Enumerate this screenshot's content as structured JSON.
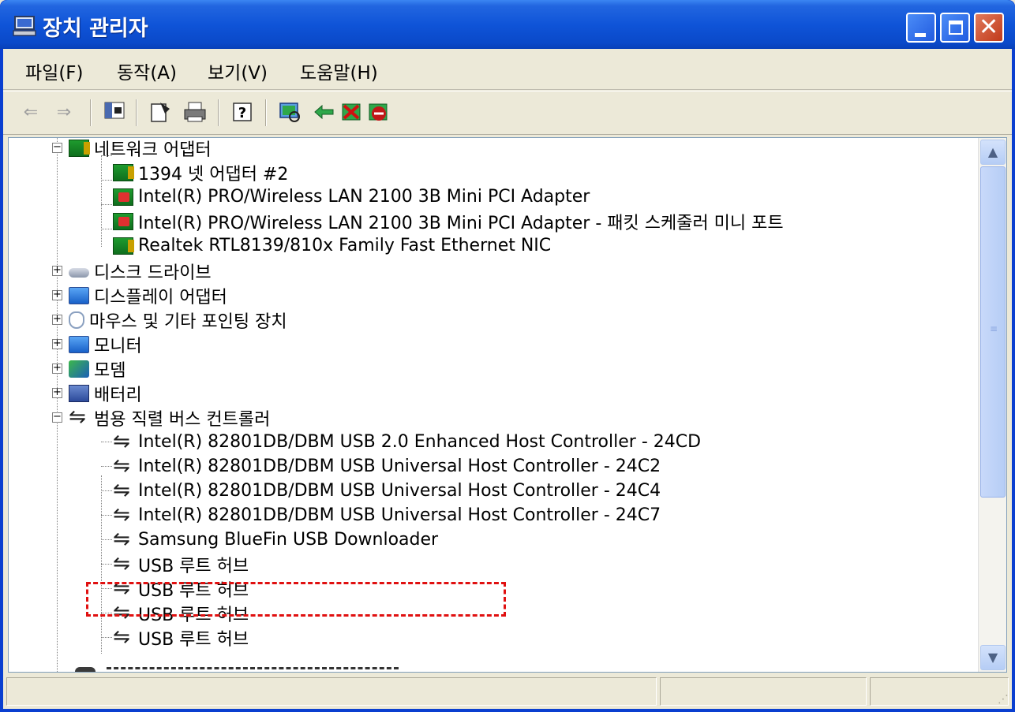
{
  "window": {
    "title": "장치 관리자",
    "controls": [
      "minimize",
      "maximize",
      "close"
    ]
  },
  "menu": [
    {
      "label": "파일(F)"
    },
    {
      "label": "동작(A)"
    },
    {
      "label": "보기(V)"
    },
    {
      "label": "도움말(H)"
    }
  ],
  "toolbar": {
    "icons": [
      "back-arrow-icon",
      "forward-arrow-icon",
      "show-hide-console-tree-icon",
      "properties-icon",
      "print-icon",
      "help-icon",
      "scan-hardware-icon",
      "update-driver-icon",
      "uninstall-icon",
      "disable-icon"
    ]
  },
  "tree": {
    "items": [
      {
        "label": "네트워크 어댑터",
        "level": 0,
        "expanded": true,
        "icon": "network-adapter-icon"
      },
      {
        "label": "1394 넷 어댑터 #2",
        "level": 1,
        "icon": "network-adapter-icon"
      },
      {
        "label": "Intel(R) PRO/Wireless LAN 2100 3B Mini PCI Adapter",
        "level": 1,
        "icon": "wireless-adapter-icon"
      },
      {
        "label": "Intel(R) PRO/Wireless LAN 2100 3B Mini PCI Adapter - 패킷 스케줄러 미니 포트",
        "level": 1,
        "icon": "wireless-adapter-icon"
      },
      {
        "label": "Realtek RTL8139/810x Family Fast Ethernet NIC",
        "level": 1,
        "icon": "network-adapter-icon"
      },
      {
        "label": "디스크 드라이브",
        "level": 0,
        "expanded": false,
        "icon": "disk-drive-icon"
      },
      {
        "label": "디스플레이 어댑터",
        "level": 0,
        "expanded": false,
        "icon": "display-adapter-icon"
      },
      {
        "label": "마우스 및 기타 포인팅 장치",
        "level": 0,
        "expanded": false,
        "icon": "mouse-icon"
      },
      {
        "label": "모니터",
        "level": 0,
        "expanded": false,
        "icon": "monitor-icon"
      },
      {
        "label": "모뎀",
        "level": 0,
        "expanded": false,
        "icon": "modem-icon"
      },
      {
        "label": "배터리",
        "level": 0,
        "expanded": false,
        "icon": "battery-icon"
      },
      {
        "label": "범용 직렬 버스 컨트롤러",
        "level": 0,
        "expanded": true,
        "icon": "usb-icon"
      },
      {
        "label": "Intel(R) 82801DB/DBM USB 2.0 Enhanced Host Controller - 24CD",
        "level": 1,
        "icon": "usb-icon"
      },
      {
        "label": "Intel(R) 82801DB/DBM USB Universal Host Controller - 24C2",
        "level": 1,
        "icon": "usb-icon"
      },
      {
        "label": "Intel(R) 82801DB/DBM USB Universal Host Controller - 24C4",
        "level": 1,
        "icon": "usb-icon"
      },
      {
        "label": "Intel(R) 82801DB/DBM USB Universal Host Controller - 24C7",
        "level": 1,
        "icon": "usb-icon"
      },
      {
        "label": "Samsung BlueFin USB Downloader",
        "level": 1,
        "icon": "usb-icon",
        "highlighted": true
      },
      {
        "label": "USB 루트 허브",
        "level": 1,
        "icon": "usb-icon"
      },
      {
        "label": "USB 루트 허브",
        "level": 1,
        "icon": "usb-icon"
      },
      {
        "label": "USB 루트 허브",
        "level": 1,
        "icon": "usb-icon"
      },
      {
        "label": "USB 루트 허브",
        "level": 1,
        "icon": "usb-icon"
      }
    ]
  },
  "colors": {
    "titlebar": "#0f54d8",
    "highlight_border": "#e01010",
    "window_bg": "#ece9d8"
  }
}
